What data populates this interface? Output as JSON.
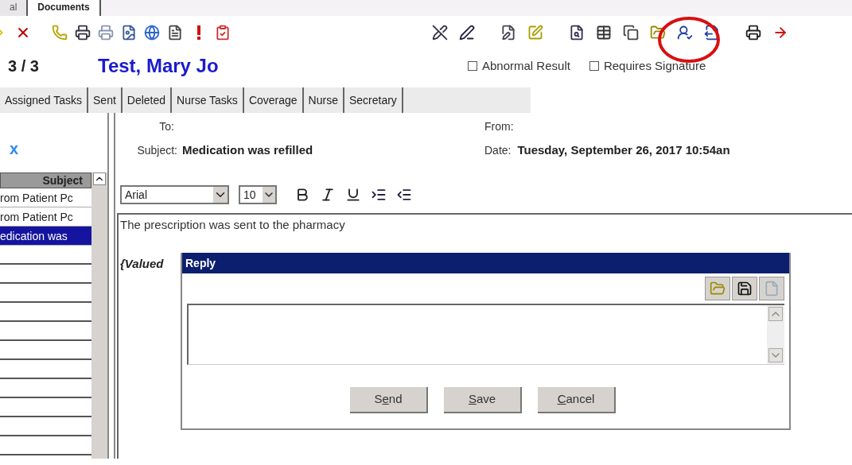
{
  "top_tabs": [
    {
      "label": "al",
      "selected": false
    },
    {
      "label": "Documents",
      "selected": true
    }
  ],
  "message_counter": "3 / 3",
  "patient_name": "Test, Mary Jo",
  "flags": [
    {
      "label": "Abnormal Result",
      "checked": false
    },
    {
      "label": "Requires Signature",
      "checked": false
    }
  ],
  "folder_tabs": [
    {
      "label": "Assigned Tasks",
      "selected": false
    },
    {
      "label": "Sent",
      "selected": false
    },
    {
      "label": "Deleted",
      "selected": false
    },
    {
      "label": "Nurse Tasks",
      "selected": false
    },
    {
      "label": "Coverage",
      "selected": false
    },
    {
      "label": "Nurse",
      "selected": false
    },
    {
      "label": "Secretary",
      "selected": false
    }
  ],
  "list": {
    "close_glyph": "x",
    "column": "Subject",
    "rows": [
      {
        "subject": "rom Patient Pc",
        "selected": false
      },
      {
        "subject": "rom Patient Pc",
        "selected": false
      },
      {
        "subject": "edication was",
        "selected": true
      }
    ]
  },
  "header": {
    "to_label": "To:",
    "subject_label": "Subject:",
    "subject": "Medication was refilled",
    "from_label": "From:",
    "date_label": "Date:",
    "date": "Tuesday, September 26, 2017 10:54an"
  },
  "editor": {
    "font": "Arial",
    "size": "10",
    "body": "The prescription was sent to the pharmacy",
    "signature": "{Valued"
  },
  "reply_dialog": {
    "title": "Reply",
    "buttons": [
      {
        "prefix": "S",
        "key": "e",
        "rest": "nd"
      },
      {
        "key": "S",
        "rest": "ave"
      },
      {
        "key": "C",
        "rest": "ancel"
      }
    ]
  }
}
